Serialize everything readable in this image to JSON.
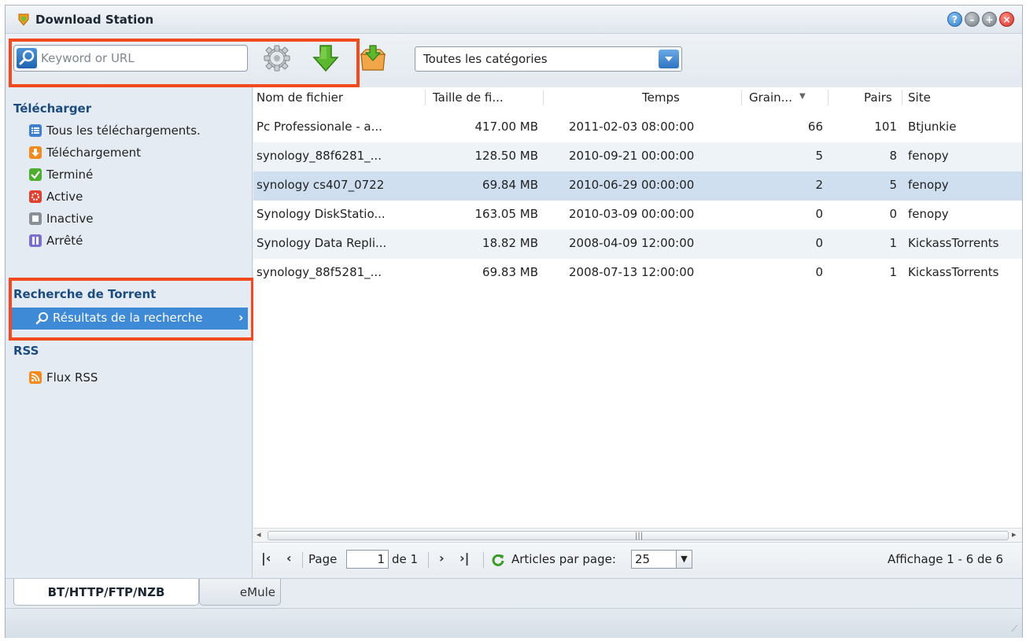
{
  "window": {
    "title": "Download Station",
    "buttons": [
      "help",
      "minimize",
      "maximize",
      "close"
    ]
  },
  "toolbar": {
    "search_placeholder": "Keyword or URL",
    "category": "Toutes les catégories"
  },
  "sidebar": {
    "groups": [
      {
        "label": "Télécharger",
        "items": [
          {
            "label": "Tous les téléchargements.",
            "icon": "list-icon"
          },
          {
            "label": "Téléchargement",
            "icon": "download-arrow-icon"
          },
          {
            "label": "Terminé",
            "icon": "checkmark-icon"
          },
          {
            "label": "Active",
            "icon": "active-icon"
          },
          {
            "label": "Inactive",
            "icon": "inactive-icon"
          },
          {
            "label": "Arrêté",
            "icon": "pause-icon"
          }
        ]
      },
      {
        "label": "Recherche de Torrent",
        "items": [
          {
            "label": "Résultats de la recherche",
            "icon": "search-icon",
            "selected": true
          }
        ]
      },
      {
        "label": "RSS",
        "items": [
          {
            "label": "Flux RSS",
            "icon": "rss-icon"
          }
        ]
      }
    ]
  },
  "table": {
    "columns": [
      "Nom de fichier",
      "Taille de fi...",
      "Temps",
      "Grain...",
      "Pairs",
      "Site"
    ],
    "rows": [
      {
        "name": "Pc Professionale - a...",
        "size": "417.00 MB",
        "time": "2011-02-03 08:00:00",
        "seeds": "66",
        "peers": "101",
        "site": "Btjunkie"
      },
      {
        "name": "synology_88f6281_...",
        "size": "128.50 MB",
        "time": "2010-09-21 00:00:00",
        "seeds": "5",
        "peers": "8",
        "site": "fenopy"
      },
      {
        "name": "synology cs407_0722",
        "size": "69.84 MB",
        "time": "2010-06-29 00:00:00",
        "seeds": "2",
        "peers": "5",
        "site": "fenopy"
      },
      {
        "name": "Synology DiskStatio...",
        "size": "163.05 MB",
        "time": "2010-03-09 00:00:00",
        "seeds": "0",
        "peers": "0",
        "site": "fenopy"
      },
      {
        "name": "Synology Data Repli...",
        "size": "18.82 MB",
        "time": "2008-04-09 12:00:00",
        "seeds": "0",
        "peers": "1",
        "site": "KickassTorrents"
      },
      {
        "name": "synology_88f5281_...",
        "size": "69.83 MB",
        "time": "2008-07-13 12:00:00",
        "seeds": "0",
        "peers": "1",
        "site": "KickassTorrents"
      }
    ],
    "selected_row": 2
  },
  "pager": {
    "page_label": "Page",
    "page_value": "1",
    "of_label": "de 1",
    "per_page_label": "Articles par page:",
    "per_page_value": "25",
    "display_text": "Affichage 1 - 6 de 6"
  },
  "tabs": [
    "BT/HTTP/FTP/NZB",
    "eMule"
  ],
  "colors": {
    "highlight": "#f04a1e",
    "selection": "#3e8ad6",
    "group_label": "#1b4c80"
  }
}
